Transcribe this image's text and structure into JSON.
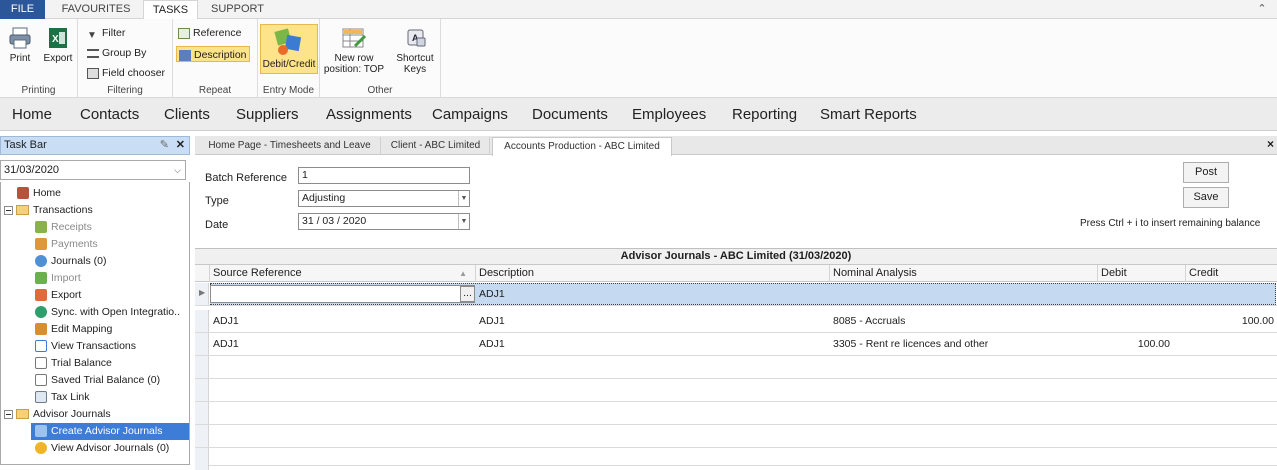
{
  "menu": {
    "tabs": [
      "FILE",
      "FAVOURITES",
      "TASKS",
      "SUPPORT"
    ],
    "active": "TASKS"
  },
  "ribbon": {
    "printing": {
      "print": "Print",
      "export": "Export",
      "label": "Printing"
    },
    "filtering": {
      "filter": "Filter",
      "group_by": "Group By",
      "field_chooser": "Field chooser",
      "label": "Filtering"
    },
    "repeat": {
      "reference": "Reference",
      "description": "Description",
      "label": "Repeat"
    },
    "entry_mode": {
      "debit_credit": "Debit/Credit",
      "label": "Entry Mode"
    },
    "other": {
      "new_row_line1": "New row",
      "new_row_line2": "position: TOP",
      "shortcut_line1": "Shortcut",
      "shortcut_line2": "Keys",
      "label": "Other"
    }
  },
  "nav": [
    "Home",
    "Contacts",
    "Clients",
    "Suppliers",
    "Assignments",
    "Campaigns",
    "Documents",
    "Employees",
    "Reporting",
    "Smart Reports"
  ],
  "taskbar": {
    "title": "Task Bar",
    "date": "31/03/2020",
    "items": [
      {
        "label": "Home"
      },
      {
        "label": "Transactions"
      },
      {
        "label": "Receipts"
      },
      {
        "label": "Payments"
      },
      {
        "label": "Journals (0)"
      },
      {
        "label": "Import"
      },
      {
        "label": "Export"
      },
      {
        "label": "Sync. with Open Integratio.."
      },
      {
        "label": "Edit Mapping"
      },
      {
        "label": "View Transactions"
      },
      {
        "label": "Trial Balance"
      },
      {
        "label": "Saved Trial Balance (0)"
      },
      {
        "label": "Tax Link"
      },
      {
        "label": "Advisor Journals"
      },
      {
        "label": "Create Advisor Journals"
      },
      {
        "label": "View Advisor Journals (0)"
      }
    ]
  },
  "doc_tabs": [
    "Home Page - Timesheets and Leave",
    "Client - ABC Limited",
    "Accounts Production - ABC Limited"
  ],
  "form": {
    "batch_ref_label": "Batch Reference",
    "batch_ref_value": "1",
    "type_label": "Type",
    "type_value": "Adjusting",
    "date_label": "Date",
    "date_value": "31 / 03 / 2020",
    "post": "Post",
    "save": "Save",
    "hint": "Press Ctrl + i to insert remaining balance"
  },
  "grid": {
    "title": "Advisor Journals - ABC Limited (31/03/2020)",
    "columns": [
      "Source Reference",
      "Description",
      "Nominal Analysis",
      "Debit",
      "Credit"
    ],
    "new_row": {
      "source": "",
      "description": "ADJ1",
      "button": "..."
    },
    "rows": [
      {
        "source": "ADJ1",
        "description": "ADJ1",
        "nominal": "8085 - Accruals",
        "debit": "",
        "credit": "100.00"
      },
      {
        "source": "ADJ1",
        "description": "ADJ1",
        "nominal": "3305 - Rent re licences and other",
        "debit": "100.00",
        "credit": ""
      }
    ]
  },
  "colors": {
    "file_tab": "#2b579a",
    "selection": "#3d7dd8",
    "highlight": "#fde38a"
  }
}
